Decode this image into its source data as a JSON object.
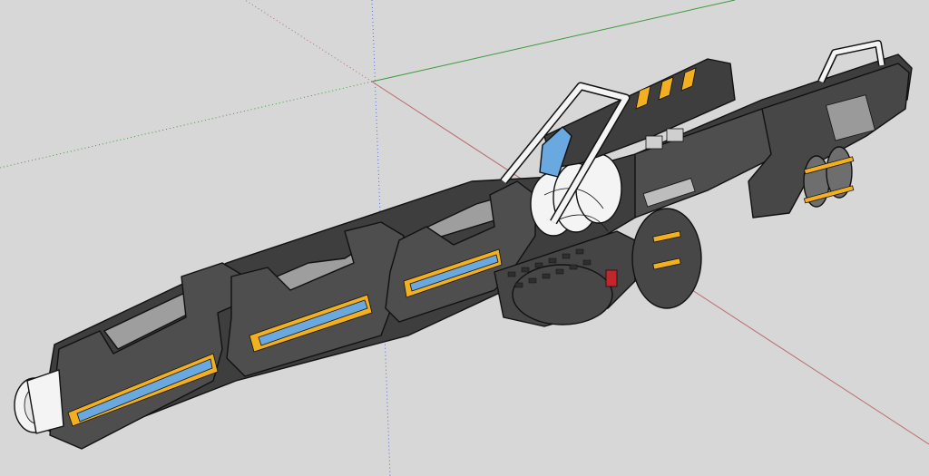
{
  "scene": {
    "background": "#d7d7d7",
    "axis_colors": {
      "red": "#b86a6a",
      "green": "#3c9a3c",
      "blue": "#5a6fc8"
    },
    "model": {
      "body_color": "#4a4a4a",
      "panel_color": "#5a5a5a",
      "bevel_color": "#9a9a9a",
      "accent_color": "#f2b021",
      "glass_color": "#6aa8e0",
      "trim_color": "#ffffff",
      "button_color": "#c0262b"
    }
  }
}
